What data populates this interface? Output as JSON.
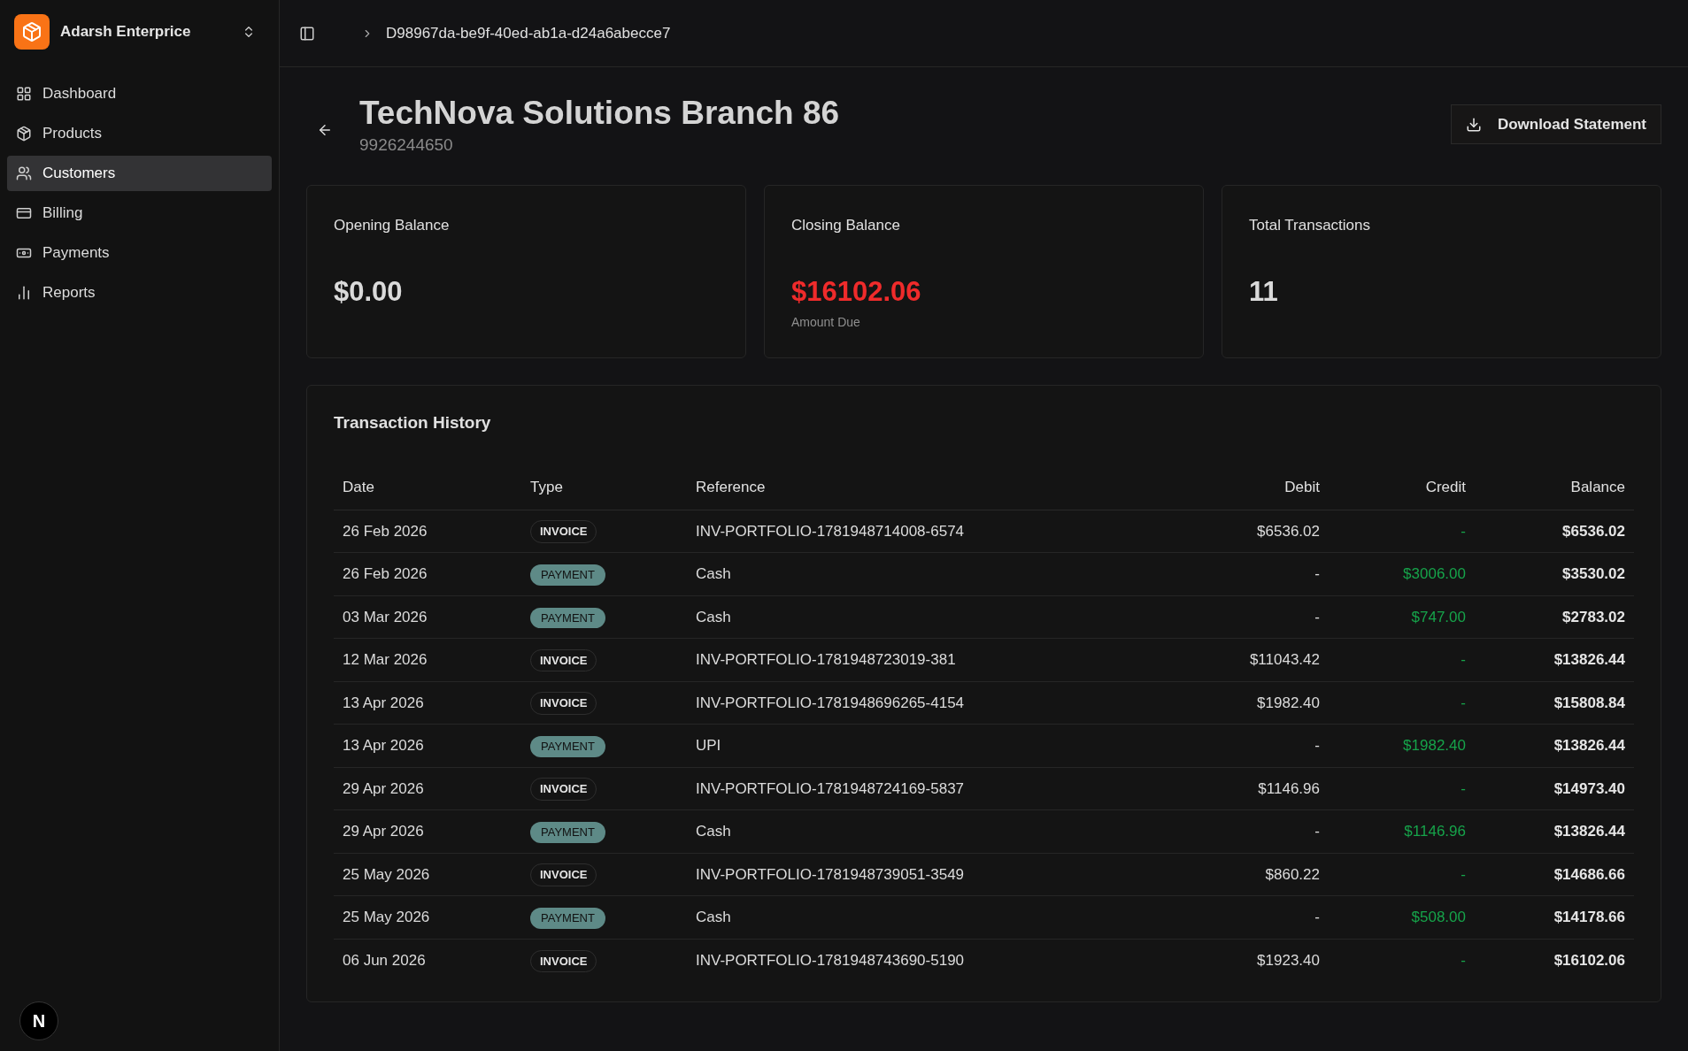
{
  "sidebar": {
    "org_name": "Adarsh Enterprice",
    "items": [
      {
        "label": "Dashboard",
        "selected": false
      },
      {
        "label": "Products",
        "selected": false
      },
      {
        "label": "Customers",
        "selected": true
      },
      {
        "label": "Billing",
        "selected": false
      },
      {
        "label": "Payments",
        "selected": false
      },
      {
        "label": "Reports",
        "selected": false
      }
    ],
    "dev_badge": "N"
  },
  "breadcrumb": "D98967da-be9f-40ed-ab1a-d24a6abecce7",
  "header": {
    "title": "TechNova Solutions Branch 86",
    "subtitle": "9926244650",
    "download_button": "Download Statement"
  },
  "cards": [
    {
      "label": "Opening Balance",
      "value": "$0.00",
      "kind": "plain"
    },
    {
      "label": "Closing Balance",
      "value": "$16102.06",
      "kind": "due",
      "note": "Amount Due"
    },
    {
      "label": "Total Transactions",
      "value": "11",
      "kind": "plain"
    }
  ],
  "transactions": {
    "title": "Transaction History",
    "columns": [
      "Date",
      "Type",
      "Reference",
      "Debit",
      "Credit",
      "Balance"
    ],
    "rows": [
      {
        "date": "26 Feb 2026",
        "type": "INVOICE",
        "kind": "invoice",
        "reference": "INV-PORTFOLIO-1781948714008-6574",
        "debit": "$6536.02",
        "credit": "-",
        "balance": "$6536.02"
      },
      {
        "date": "26 Feb 2026",
        "type": "PAYMENT",
        "kind": "payment",
        "reference": "Cash",
        "debit": "-",
        "credit": "$3006.00",
        "balance": "$3530.02"
      },
      {
        "date": "03 Mar 2026",
        "type": "PAYMENT",
        "kind": "payment",
        "reference": "Cash",
        "debit": "-",
        "credit": "$747.00",
        "balance": "$2783.02"
      },
      {
        "date": "12 Mar 2026",
        "type": "INVOICE",
        "kind": "invoice",
        "reference": "INV-PORTFOLIO-1781948723019-381",
        "debit": "$11043.42",
        "credit": "-",
        "balance": "$13826.44"
      },
      {
        "date": "13 Apr 2026",
        "type": "INVOICE",
        "kind": "invoice",
        "reference": "INV-PORTFOLIO-1781948696265-4154",
        "debit": "$1982.40",
        "credit": "-",
        "balance": "$15808.84"
      },
      {
        "date": "13 Apr 2026",
        "type": "PAYMENT",
        "kind": "payment",
        "reference": "UPI",
        "debit": "-",
        "credit": "$1982.40",
        "balance": "$13826.44"
      },
      {
        "date": "29 Apr 2026",
        "type": "INVOICE",
        "kind": "invoice",
        "reference": "INV-PORTFOLIO-1781948724169-5837",
        "debit": "$1146.96",
        "credit": "-",
        "balance": "$14973.40"
      },
      {
        "date": "29 Apr 2026",
        "type": "PAYMENT",
        "kind": "payment",
        "reference": "Cash",
        "debit": "-",
        "credit": "$1146.96",
        "balance": "$13826.44"
      },
      {
        "date": "25 May 2026",
        "type": "INVOICE",
        "kind": "invoice",
        "reference": "INV-PORTFOLIO-1781948739051-3549",
        "debit": "$860.22",
        "credit": "-",
        "balance": "$14686.66"
      },
      {
        "date": "25 May 2026",
        "type": "PAYMENT",
        "kind": "payment",
        "reference": "Cash",
        "debit": "-",
        "credit": "$508.00",
        "balance": "$14178.66"
      },
      {
        "date": "06 Jun 2026",
        "type": "INVOICE",
        "kind": "invoice",
        "reference": "INV-PORTFOLIO-1781948743690-5190",
        "debit": "$1923.40",
        "credit": "-",
        "balance": "$16102.06"
      }
    ]
  }
}
